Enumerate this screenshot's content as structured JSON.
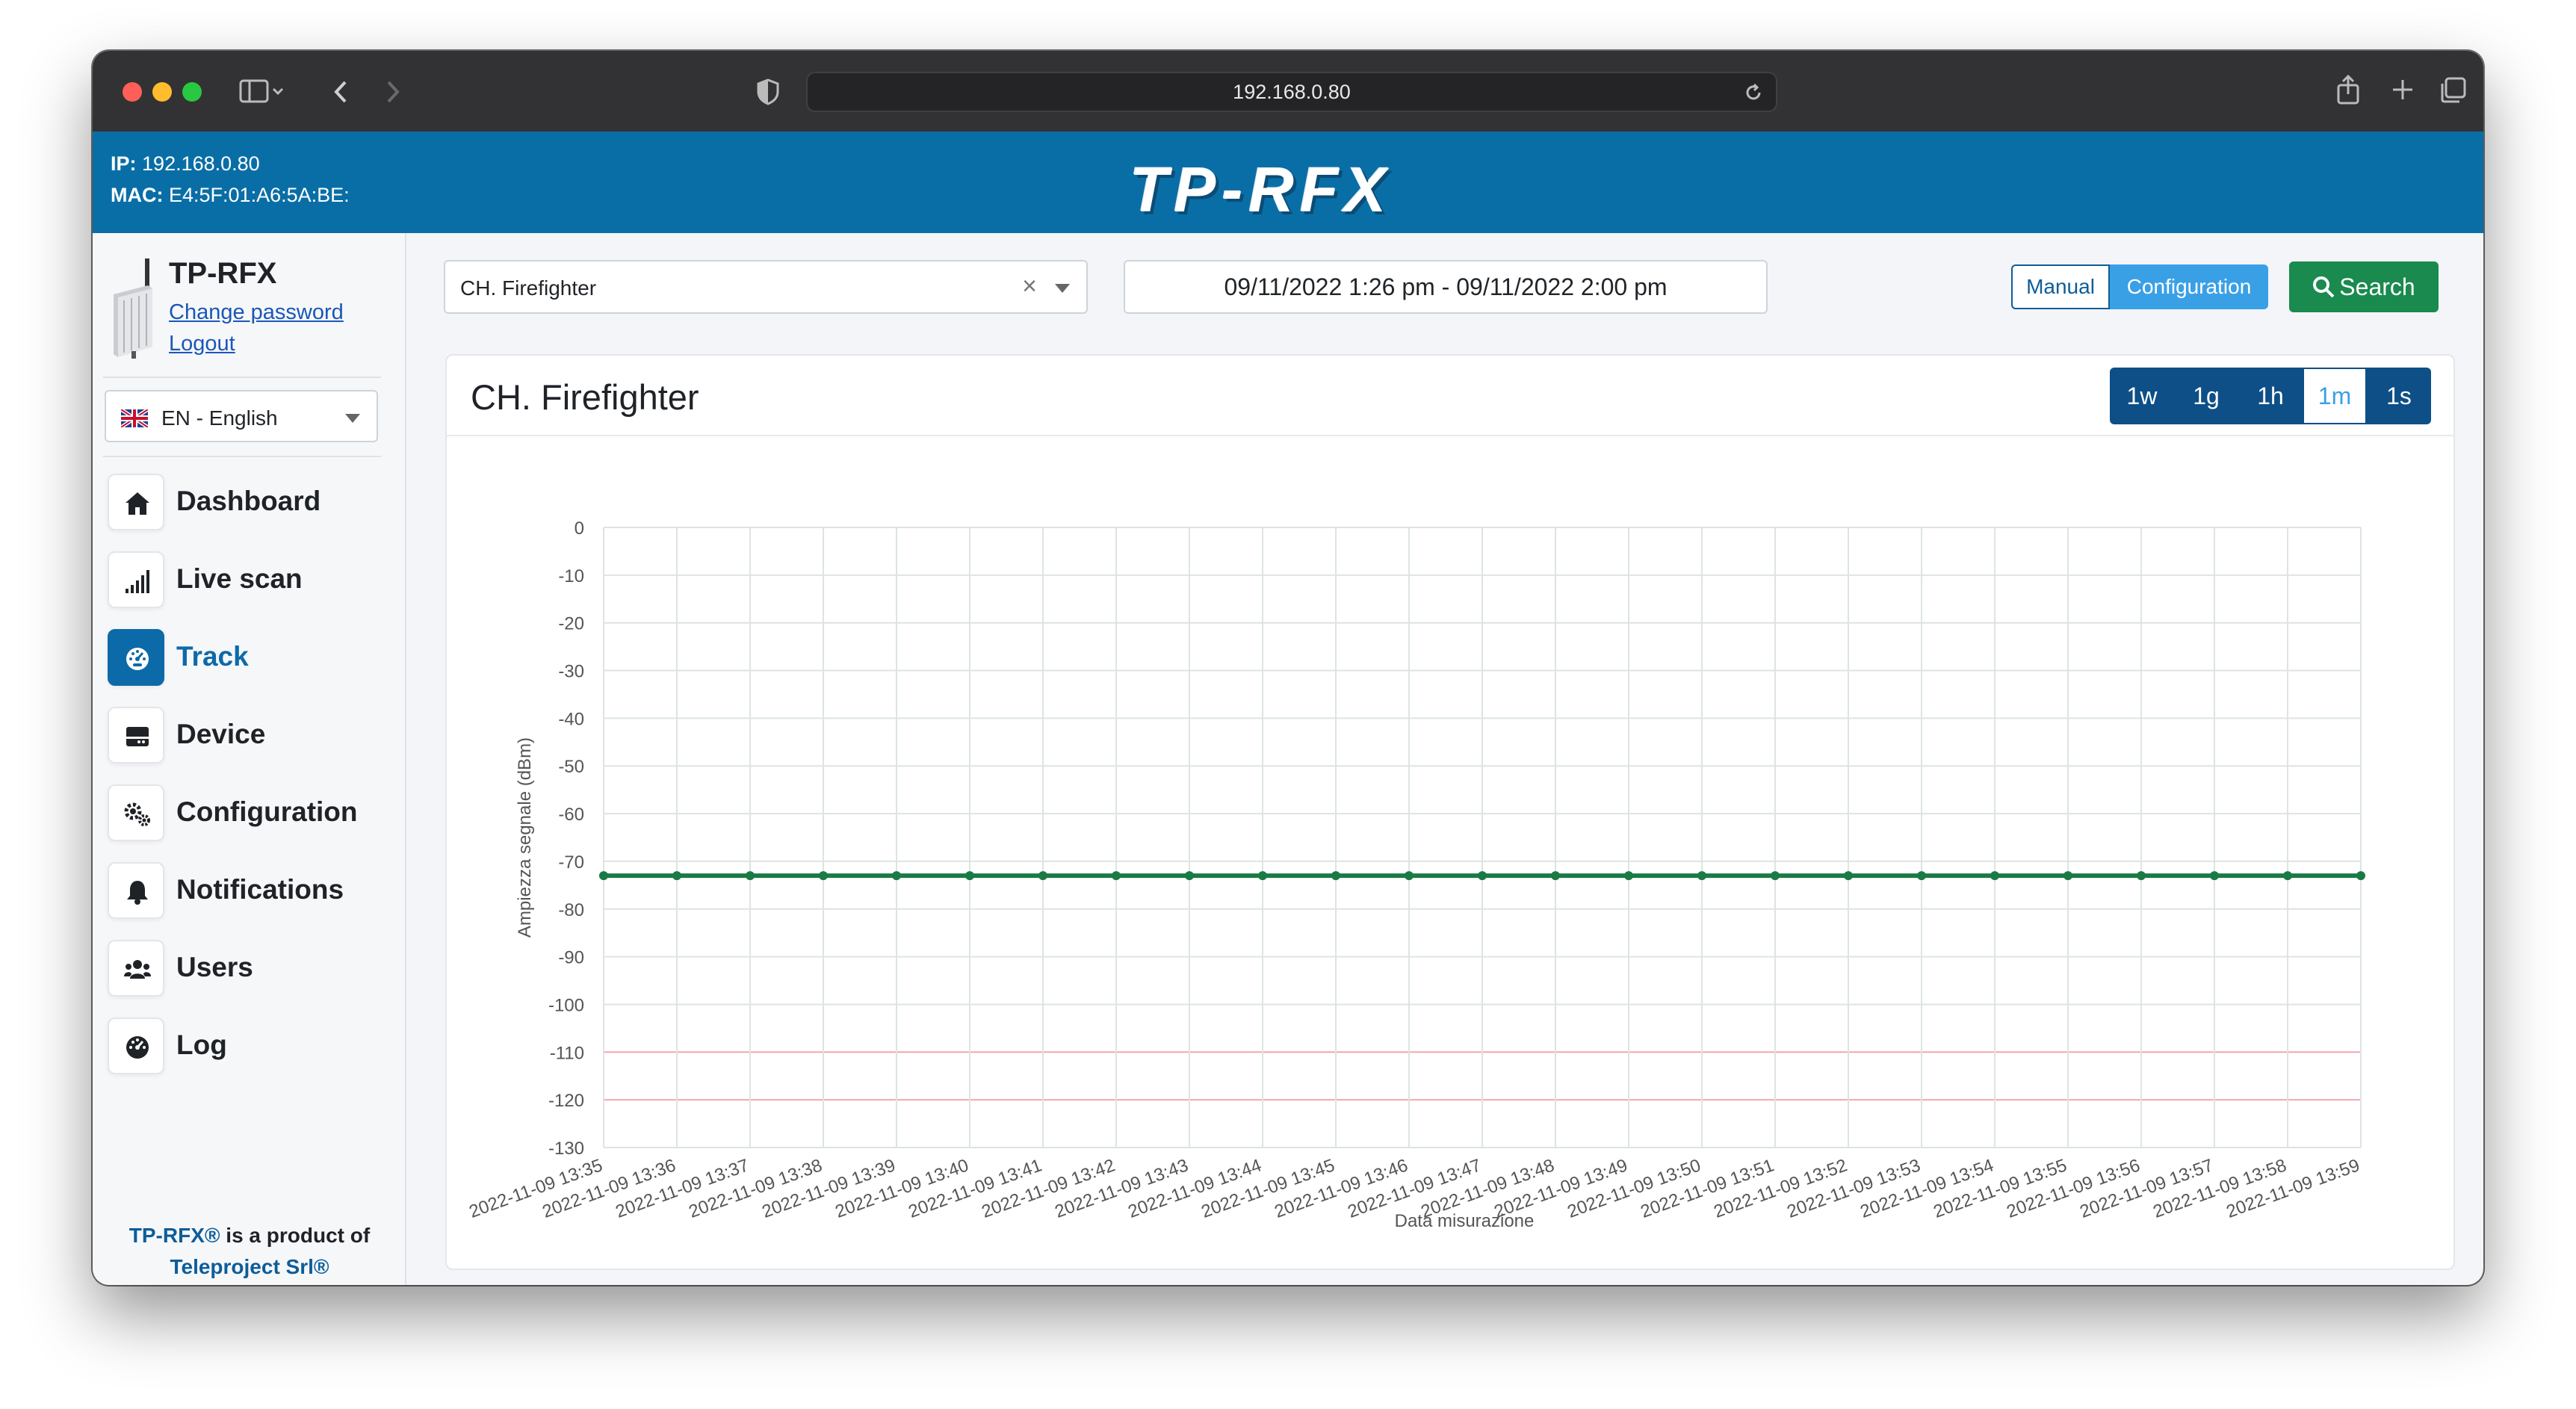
{
  "browser": {
    "url": "192.168.0.80"
  },
  "header": {
    "ip_label": "IP:",
    "ip_value": "192.168.0.80",
    "mac_label": "MAC:",
    "mac_value": "E4:5F:01:A6:5A:BE:",
    "logo_text": "TP-RFX"
  },
  "sidebar": {
    "brand": "TP-RFX",
    "change_password": "Change password",
    "logout": "Logout",
    "language": "EN - English",
    "items": [
      {
        "label": "Dashboard",
        "icon": "home-icon"
      },
      {
        "label": "Live scan",
        "icon": "signal-bars-icon"
      },
      {
        "label": "Track",
        "icon": "gauge-icon",
        "active": true
      },
      {
        "label": "Device",
        "icon": "device-icon"
      },
      {
        "label": "Configuration",
        "icon": "gears-icon"
      },
      {
        "label": "Notifications",
        "icon": "bell-icon"
      },
      {
        "label": "Users",
        "icon": "users-icon"
      },
      {
        "label": "Log",
        "icon": "log-gauge-icon"
      }
    ],
    "footer_line1_brand": "TP-RFX®",
    "footer_line1_rest": " is a product of",
    "footer_line2": "Teleproject Srl®"
  },
  "toolbar": {
    "channel": "CH. Firefighter",
    "date_range": "09/11/2022 1:26 pm - 09/11/2022 2:00 pm",
    "manual_label": "Manual",
    "configuration_label": "Configuration",
    "search_label": "Search"
  },
  "card": {
    "title": "CH. Firefighter",
    "ranges": [
      "1w",
      "1g",
      "1h",
      "1m",
      "1s"
    ],
    "selected_range": "1m"
  },
  "colors": {
    "header_blue": "#0a6ea6",
    "series_green": "#1a7a45",
    "threshold_red": "#f2a6ae",
    "grid": "#dde4e1",
    "search_green": "#1a8a4f",
    "accent_blue": "#3aa0e6"
  },
  "chart_data": {
    "type": "line",
    "xlabel": "Data misurazione",
    "ylabel": "Ampiezza segnale (dBm)",
    "ylim": [
      -130,
      0
    ],
    "yticks": [
      0,
      -10,
      -20,
      -30,
      -40,
      -50,
      -60,
      -70,
      -80,
      -90,
      -100,
      -110,
      -120,
      -130
    ],
    "categories": [
      "2022-11-09 13:35",
      "2022-11-09 13:36",
      "2022-11-09 13:37",
      "2022-11-09 13:38",
      "2022-11-09 13:39",
      "2022-11-09 13:40",
      "2022-11-09 13:41",
      "2022-11-09 13:42",
      "2022-11-09 13:43",
      "2022-11-09 13:44",
      "2022-11-09 13:45",
      "2022-11-09 13:46",
      "2022-11-09 13:47",
      "2022-11-09 13:48",
      "2022-11-09 13:49",
      "2022-11-09 13:50",
      "2022-11-09 13:51",
      "2022-11-09 13:52",
      "2022-11-09 13:53",
      "2022-11-09 13:54",
      "2022-11-09 13:55",
      "2022-11-09 13:56",
      "2022-11-09 13:57",
      "2022-11-09 13:58",
      "2022-11-09 13:59"
    ],
    "series": [
      {
        "values": [
          -73,
          -73,
          -73,
          -73,
          -73,
          -73,
          -73,
          -73,
          -73,
          -73,
          -73,
          -73,
          -73,
          -73,
          -73,
          -73,
          -73,
          -73,
          -73,
          -73,
          -73,
          -73,
          -73,
          -73,
          -73
        ]
      }
    ],
    "threshold_lines": [
      -110,
      -120
    ],
    "grid": true
  }
}
